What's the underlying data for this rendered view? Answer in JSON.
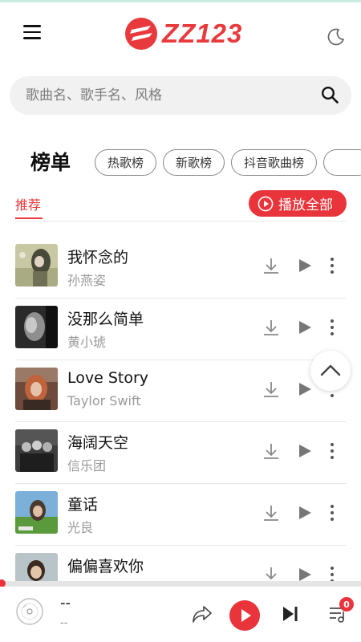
{
  "app": {
    "brand_name": "ZZ123",
    "brand_color": "#e83a3d",
    "icons": {
      "menu": "menu-icon",
      "theme": "moon-icon",
      "search": "search-icon"
    }
  },
  "search": {
    "placeholder": "歌曲名、歌手名、风格",
    "value": ""
  },
  "charts": {
    "title": "榜单",
    "chips": [
      "热歌榜",
      "新歌榜",
      "抖音歌曲榜"
    ],
    "active_tab": "推荐",
    "play_all_label": "播放全部"
  },
  "songs": [
    {
      "title": "我怀念的",
      "artist": "孙燕姿"
    },
    {
      "title": "没那么简单",
      "artist": "黄小琥"
    },
    {
      "title": "Love Story",
      "artist": "Taylor Swift"
    },
    {
      "title": "海阔天空",
      "artist": "信乐团"
    },
    {
      "title": "童话",
      "artist": "光良"
    },
    {
      "title": "偏偏喜欢你",
      "artist": ""
    }
  ],
  "player": {
    "now_title": "--",
    "now_artist": "--",
    "queue_count": "0",
    "progress": 0
  }
}
